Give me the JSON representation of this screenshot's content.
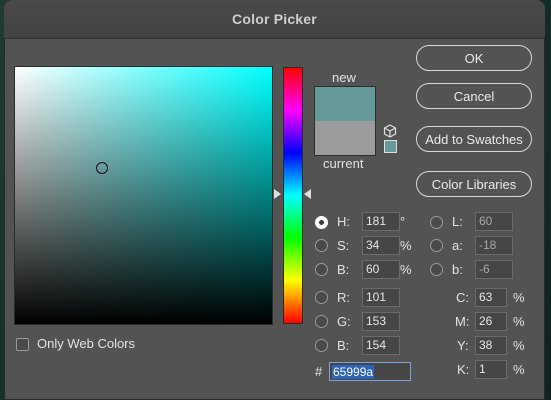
{
  "window": {
    "title": "Color Picker"
  },
  "preview": {
    "new_label": "new",
    "current_label": "current",
    "new_color": "#65999a",
    "current_color": "#9b9b9b"
  },
  "buttons": {
    "ok": "OK",
    "cancel": "Cancel",
    "add_to_swatches": "Add to Swatches",
    "color_libraries": "Color Libraries"
  },
  "options": {
    "only_web_colors": "Only Web Colors"
  },
  "hsb": {
    "h_label": "H:",
    "h_value": "181",
    "h_unit": "°",
    "s_label": "S:",
    "s_value": "34",
    "s_unit": "%",
    "b_label": "B:",
    "b_value": "60",
    "b_unit": "%"
  },
  "rgb": {
    "r_label": "R:",
    "r_value": "101",
    "g_label": "G:",
    "g_value": "153",
    "b_label": "B:",
    "b_value": "154"
  },
  "lab": {
    "l_label": "L:",
    "l_value": "60",
    "a_label": "a:",
    "a_value": "-18",
    "b_label": "b:",
    "b_value": "-6"
  },
  "cmyk": {
    "c_label": "C:",
    "c_value": "63",
    "c_unit": "%",
    "m_label": "M:",
    "m_value": "26",
    "m_unit": "%",
    "y_label": "Y:",
    "y_value": "38",
    "y_unit": "%",
    "k_label": "K:",
    "k_value": "1",
    "k_unit": "%"
  },
  "hex": {
    "label": "#",
    "value": "65999a"
  },
  "icons": {
    "cube": "cube-icon",
    "warning_swatch": "web-safe-swatch"
  }
}
